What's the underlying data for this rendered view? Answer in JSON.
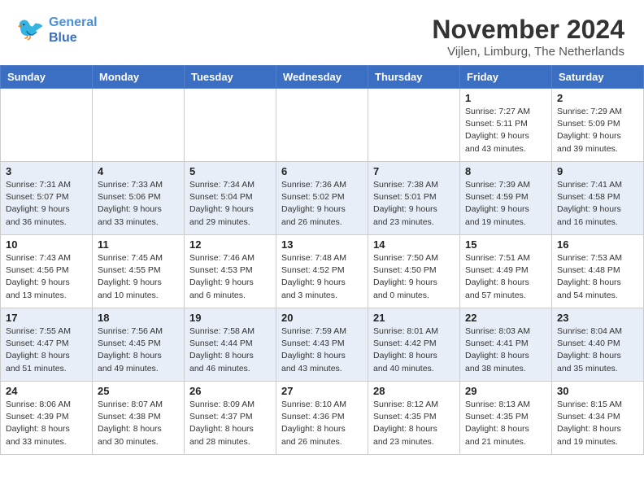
{
  "header": {
    "logo_line1": "General",
    "logo_line2": "Blue",
    "month": "November 2024",
    "location": "Vijlen, Limburg, The Netherlands"
  },
  "columns": [
    "Sunday",
    "Monday",
    "Tuesday",
    "Wednesday",
    "Thursday",
    "Friday",
    "Saturday"
  ],
  "weeks": [
    {
      "days": [
        {
          "num": "",
          "info": ""
        },
        {
          "num": "",
          "info": ""
        },
        {
          "num": "",
          "info": ""
        },
        {
          "num": "",
          "info": ""
        },
        {
          "num": "",
          "info": ""
        },
        {
          "num": "1",
          "info": "Sunrise: 7:27 AM\nSunset: 5:11 PM\nDaylight: 9 hours\nand 43 minutes."
        },
        {
          "num": "2",
          "info": "Sunrise: 7:29 AM\nSunset: 5:09 PM\nDaylight: 9 hours\nand 39 minutes."
        }
      ]
    },
    {
      "days": [
        {
          "num": "3",
          "info": "Sunrise: 7:31 AM\nSunset: 5:07 PM\nDaylight: 9 hours\nand 36 minutes."
        },
        {
          "num": "4",
          "info": "Sunrise: 7:33 AM\nSunset: 5:06 PM\nDaylight: 9 hours\nand 33 minutes."
        },
        {
          "num": "5",
          "info": "Sunrise: 7:34 AM\nSunset: 5:04 PM\nDaylight: 9 hours\nand 29 minutes."
        },
        {
          "num": "6",
          "info": "Sunrise: 7:36 AM\nSunset: 5:02 PM\nDaylight: 9 hours\nand 26 minutes."
        },
        {
          "num": "7",
          "info": "Sunrise: 7:38 AM\nSunset: 5:01 PM\nDaylight: 9 hours\nand 23 minutes."
        },
        {
          "num": "8",
          "info": "Sunrise: 7:39 AM\nSunset: 4:59 PM\nDaylight: 9 hours\nand 19 minutes."
        },
        {
          "num": "9",
          "info": "Sunrise: 7:41 AM\nSunset: 4:58 PM\nDaylight: 9 hours\nand 16 minutes."
        }
      ]
    },
    {
      "days": [
        {
          "num": "10",
          "info": "Sunrise: 7:43 AM\nSunset: 4:56 PM\nDaylight: 9 hours\nand 13 minutes."
        },
        {
          "num": "11",
          "info": "Sunrise: 7:45 AM\nSunset: 4:55 PM\nDaylight: 9 hours\nand 10 minutes."
        },
        {
          "num": "12",
          "info": "Sunrise: 7:46 AM\nSunset: 4:53 PM\nDaylight: 9 hours\nand 6 minutes."
        },
        {
          "num": "13",
          "info": "Sunrise: 7:48 AM\nSunset: 4:52 PM\nDaylight: 9 hours\nand 3 minutes."
        },
        {
          "num": "14",
          "info": "Sunrise: 7:50 AM\nSunset: 4:50 PM\nDaylight: 9 hours\nand 0 minutes."
        },
        {
          "num": "15",
          "info": "Sunrise: 7:51 AM\nSunset: 4:49 PM\nDaylight: 8 hours\nand 57 minutes."
        },
        {
          "num": "16",
          "info": "Sunrise: 7:53 AM\nSunset: 4:48 PM\nDaylight: 8 hours\nand 54 minutes."
        }
      ]
    },
    {
      "days": [
        {
          "num": "17",
          "info": "Sunrise: 7:55 AM\nSunset: 4:47 PM\nDaylight: 8 hours\nand 51 minutes."
        },
        {
          "num": "18",
          "info": "Sunrise: 7:56 AM\nSunset: 4:45 PM\nDaylight: 8 hours\nand 49 minutes."
        },
        {
          "num": "19",
          "info": "Sunrise: 7:58 AM\nSunset: 4:44 PM\nDaylight: 8 hours\nand 46 minutes."
        },
        {
          "num": "20",
          "info": "Sunrise: 7:59 AM\nSunset: 4:43 PM\nDaylight: 8 hours\nand 43 minutes."
        },
        {
          "num": "21",
          "info": "Sunrise: 8:01 AM\nSunset: 4:42 PM\nDaylight: 8 hours\nand 40 minutes."
        },
        {
          "num": "22",
          "info": "Sunrise: 8:03 AM\nSunset: 4:41 PM\nDaylight: 8 hours\nand 38 minutes."
        },
        {
          "num": "23",
          "info": "Sunrise: 8:04 AM\nSunset: 4:40 PM\nDaylight: 8 hours\nand 35 minutes."
        }
      ]
    },
    {
      "days": [
        {
          "num": "24",
          "info": "Sunrise: 8:06 AM\nSunset: 4:39 PM\nDaylight: 8 hours\nand 33 minutes."
        },
        {
          "num": "25",
          "info": "Sunrise: 8:07 AM\nSunset: 4:38 PM\nDaylight: 8 hours\nand 30 minutes."
        },
        {
          "num": "26",
          "info": "Sunrise: 8:09 AM\nSunset: 4:37 PM\nDaylight: 8 hours\nand 28 minutes."
        },
        {
          "num": "27",
          "info": "Sunrise: 8:10 AM\nSunset: 4:36 PM\nDaylight: 8 hours\nand 26 minutes."
        },
        {
          "num": "28",
          "info": "Sunrise: 8:12 AM\nSunset: 4:35 PM\nDaylight: 8 hours\nand 23 minutes."
        },
        {
          "num": "29",
          "info": "Sunrise: 8:13 AM\nSunset: 4:35 PM\nDaylight: 8 hours\nand 21 minutes."
        },
        {
          "num": "30",
          "info": "Sunrise: 8:15 AM\nSunset: 4:34 PM\nDaylight: 8 hours\nand 19 minutes."
        }
      ]
    }
  ]
}
